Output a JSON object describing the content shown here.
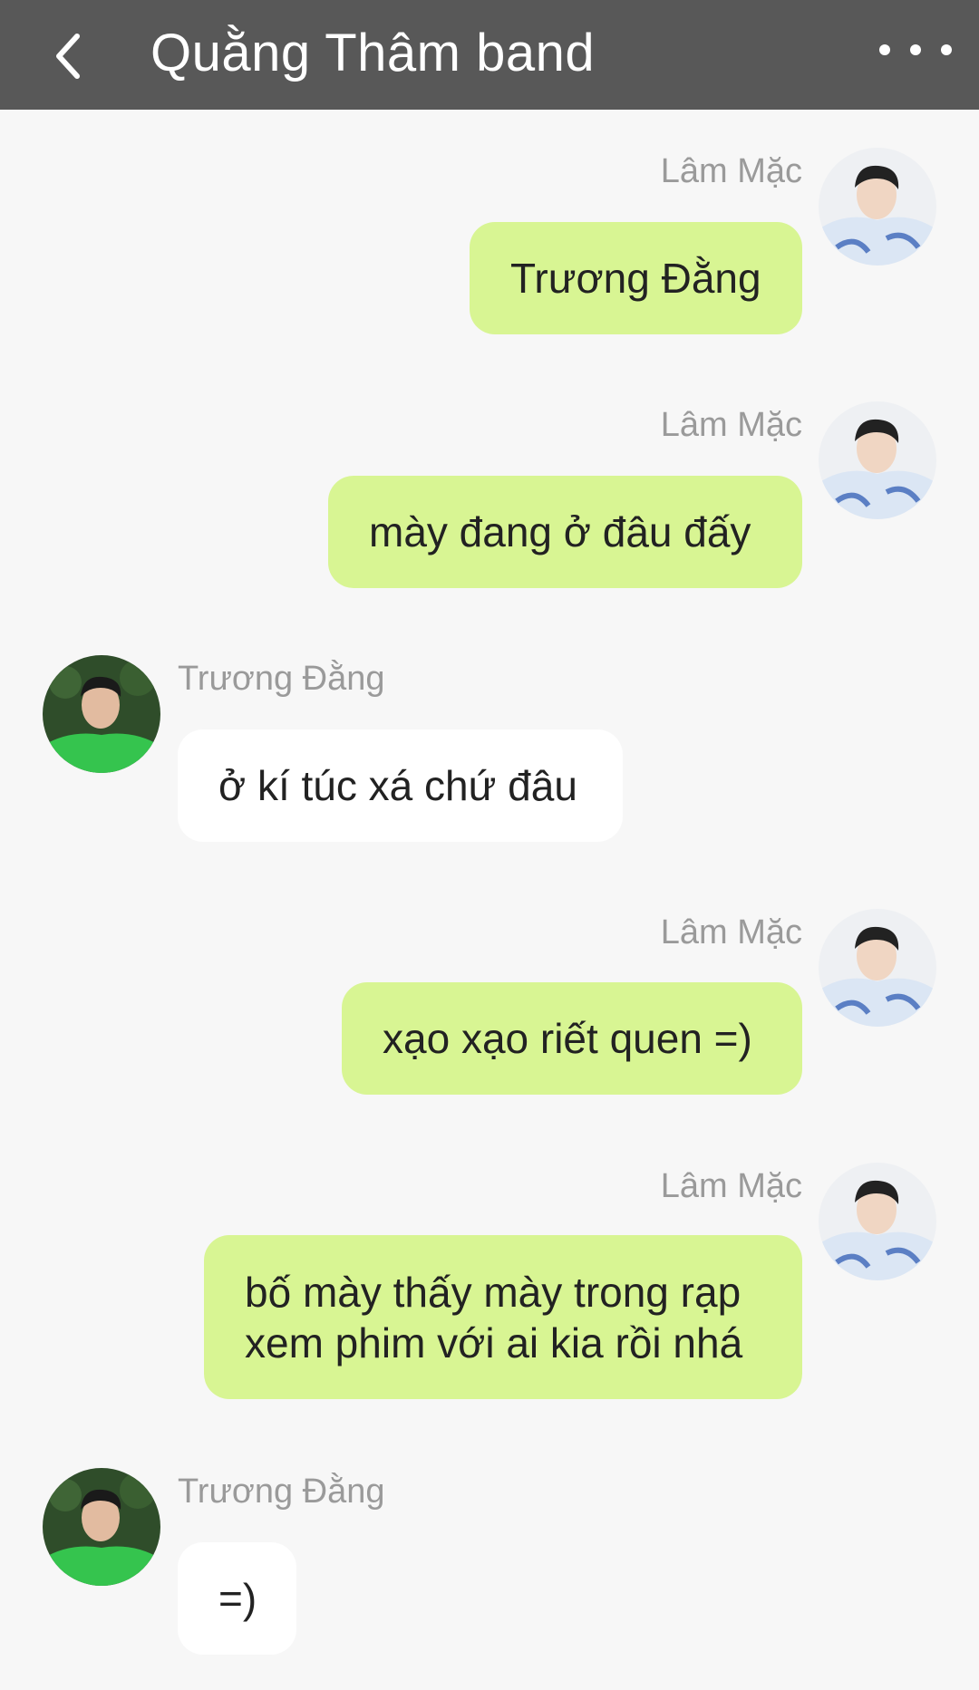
{
  "header": {
    "title": "Quằng Thâm band"
  },
  "colors": {
    "header_bg": "#585858",
    "outgoing_bubble": "#d8f593",
    "incoming_bubble": "#ffffff",
    "background": "#f7f7f7"
  },
  "messages": [
    {
      "sender": "Lâm Mặc",
      "text": "Trương Đằng",
      "side": "right"
    },
    {
      "sender": "Lâm Mặc",
      "text": "mày đang ở đâu đấy",
      "side": "right"
    },
    {
      "sender": "Trương Đằng",
      "text": "ở kí túc xá chứ đâu",
      "side": "left"
    },
    {
      "sender": "Lâm Mặc",
      "text": "xạo xạo riết quen =)",
      "side": "right"
    },
    {
      "sender": "Lâm Mặc",
      "text_lines": [
        "bố mày thấy mày trong rạp",
        "xem phim với ai kia rồi nhá"
      ],
      "side": "right"
    },
    {
      "sender": "Trương Đằng",
      "text": "=)",
      "side": "left"
    }
  ]
}
